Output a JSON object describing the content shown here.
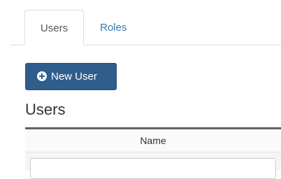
{
  "tabs": [
    {
      "label": "Users",
      "active": true
    },
    {
      "label": "Roles",
      "active": false
    }
  ],
  "toolbar": {
    "new_user_label": "New User",
    "new_user_icon": "plus-circle-icon"
  },
  "section": {
    "title": "Users"
  },
  "table": {
    "columns": [
      "Name"
    ],
    "filter_value": ""
  },
  "colors": {
    "primary_button": "#2f5d8c",
    "tab_link": "#337ab7",
    "table_header_rule": "#616161"
  }
}
